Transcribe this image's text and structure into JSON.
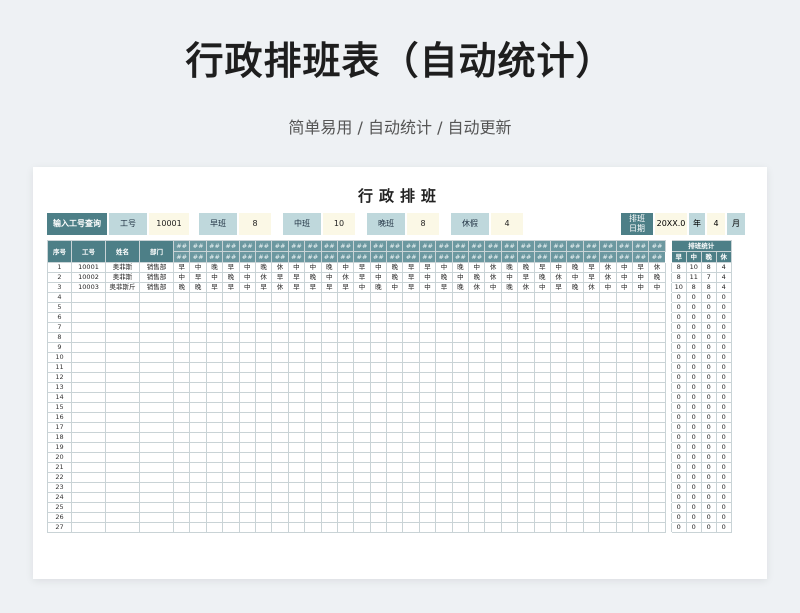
{
  "hero": {
    "title": "行政排班表（自动统计）",
    "subtitle": "简单易用  /  自动统计  /  自动更新"
  },
  "sheet": {
    "title": "行政排班",
    "query": {
      "label": "输入工号查询",
      "id_label": "工号",
      "id_value": "10001",
      "early_label": "早班",
      "early_value": "8",
      "mid_label": "中班",
      "mid_value": "10",
      "late_label": "晚班",
      "late_value": "8",
      "rest_label": "休假",
      "rest_value": "4"
    },
    "date": {
      "label_line1": "排班",
      "label_line2": "日期",
      "year": "20XX.0",
      "year_unit": "年",
      "month": "4",
      "month_unit": "月"
    },
    "headers": {
      "seq": "序号",
      "id": "工号",
      "name": "姓名",
      "dept": "部门",
      "day_placeholder": "##",
      "stats": "排班统计",
      "stat_cols": [
        "早",
        "中",
        "晚",
        "休"
      ]
    },
    "day_count": 30,
    "rows": [
      {
        "seq": "1",
        "id": "10001",
        "name": "奥菲斯",
        "dept": "销售部",
        "shifts": [
          "早",
          "中",
          "晚",
          "早",
          "中",
          "晚",
          "休",
          "中",
          "中",
          "晚",
          "中",
          "早",
          "中",
          "晚",
          "早",
          "早",
          "中",
          "晚",
          "中",
          "休",
          "晚",
          "晚",
          "早",
          "中",
          "晚",
          "早",
          "休",
          "中",
          "早",
          "休"
        ],
        "stats": [
          "8",
          "10",
          "8",
          "4"
        ]
      },
      {
        "seq": "2",
        "id": "10002",
        "name": "奥菲斯",
        "dept": "销售部",
        "shifts": [
          "中",
          "早",
          "中",
          "晚",
          "中",
          "休",
          "早",
          "早",
          "晚",
          "中",
          "休",
          "早",
          "中",
          "晚",
          "早",
          "中",
          "晚",
          "中",
          "晚",
          "休",
          "中",
          "早",
          "晚",
          "休",
          "中",
          "早",
          "休",
          "中",
          "中",
          "晚"
        ],
        "stats": [
          "8",
          "11",
          "7",
          "4"
        ]
      },
      {
        "seq": "3",
        "id": "10003",
        "name": "奥菲斯斤",
        "dept": "销售部",
        "shifts": [
          "晚",
          "晚",
          "早",
          "早",
          "中",
          "早",
          "休",
          "早",
          "早",
          "早",
          "早",
          "中",
          "晚",
          "中",
          "早",
          "中",
          "早",
          "晚",
          "休",
          "中",
          "晚",
          "休",
          "中",
          "早",
          "晚",
          "休",
          "中",
          "中",
          "中",
          "中"
        ],
        "stats": [
          "10",
          "8",
          "8",
          "4"
        ]
      }
    ],
    "empty_rows": [
      "4",
      "5",
      "6",
      "7",
      "8",
      "9",
      "10",
      "11",
      "12",
      "13",
      "14",
      "15",
      "16",
      "17",
      "18",
      "19",
      "20",
      "21",
      "22",
      "23",
      "24",
      "25",
      "26",
      "27"
    ],
    "empty_stat": "0"
  }
}
